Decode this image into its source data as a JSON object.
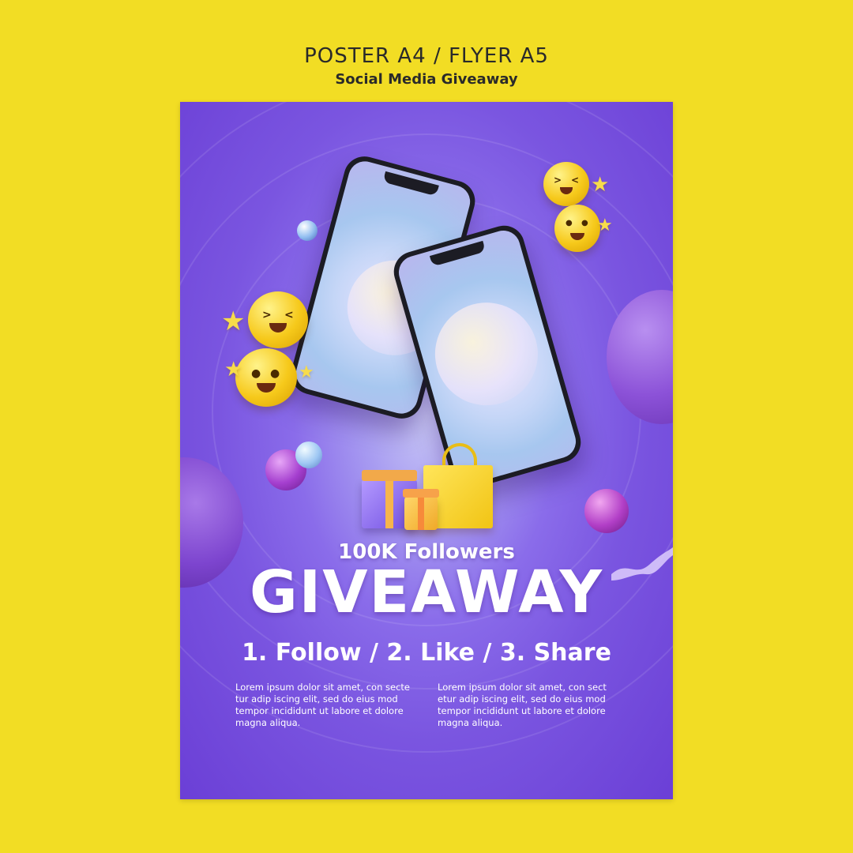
{
  "header": {
    "title": "POSTER A4 / FLYER A5",
    "subtitle": "Social Media Giveaway"
  },
  "poster": {
    "tagline": "100K Followers",
    "headline": "GIVEAWAY",
    "steps": "1. Follow /  2. Like / 3. Share",
    "body_left": "Lorem ipsum dolor sit amet, con secte tur adip iscing elit, sed do eius mod tempor incididunt ut labore et dolore magna aliqua.",
    "body_right": "Lorem ipsum dolor sit amet, con sect etur adip iscing elit, sed do eius mod tempor incididunt ut labore et dolore magna aliqua."
  },
  "icons": [
    "smiling-phone-mockup",
    "laughing-emoji-icon",
    "smiling-emoji-icon",
    "star-icon",
    "gift-box-icon",
    "shopping-bag-icon"
  ],
  "colors": {
    "background": "#F2DD24",
    "poster_primary": "#7A55E0",
    "text_light": "#FFFFFF",
    "emoji_yellow": "#F6C91B"
  }
}
